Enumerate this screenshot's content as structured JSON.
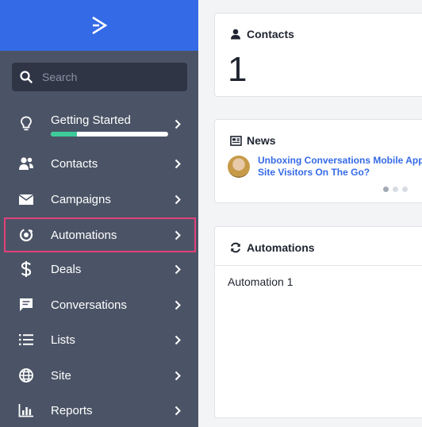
{
  "sidebar": {
    "search": {
      "placeholder": "Search"
    },
    "getting_started": {
      "label": "Getting Started",
      "progress": 0.22
    },
    "items": [
      {
        "label": "Contacts",
        "icon": "contacts-icon"
      },
      {
        "label": "Campaigns",
        "icon": "envelope-icon"
      },
      {
        "label": "Automations",
        "icon": "automations-icon",
        "active": true
      },
      {
        "label": "Deals",
        "icon": "dollar-icon"
      },
      {
        "label": "Conversations",
        "icon": "chat-icon"
      },
      {
        "label": "Lists",
        "icon": "list-icon"
      },
      {
        "label": "Site",
        "icon": "globe-icon"
      },
      {
        "label": "Reports",
        "icon": "bar-chart-icon"
      }
    ]
  },
  "contacts_card": {
    "title": "Contacts",
    "count": "1"
  },
  "news_card": {
    "title": "News",
    "headline_line1": "Unboxing Conversations Mobile App: W",
    "headline_line2": "Site Visitors On The Go?"
  },
  "automations_card": {
    "title": "Automations",
    "items": [
      "Automation 1"
    ]
  },
  "colors": {
    "sidebar_bg": "#4b5466",
    "brand_bg": "#356ae6",
    "active_outline": "#e4407c",
    "progress_fill": "#3dcb9a",
    "link": "#356ae6"
  }
}
